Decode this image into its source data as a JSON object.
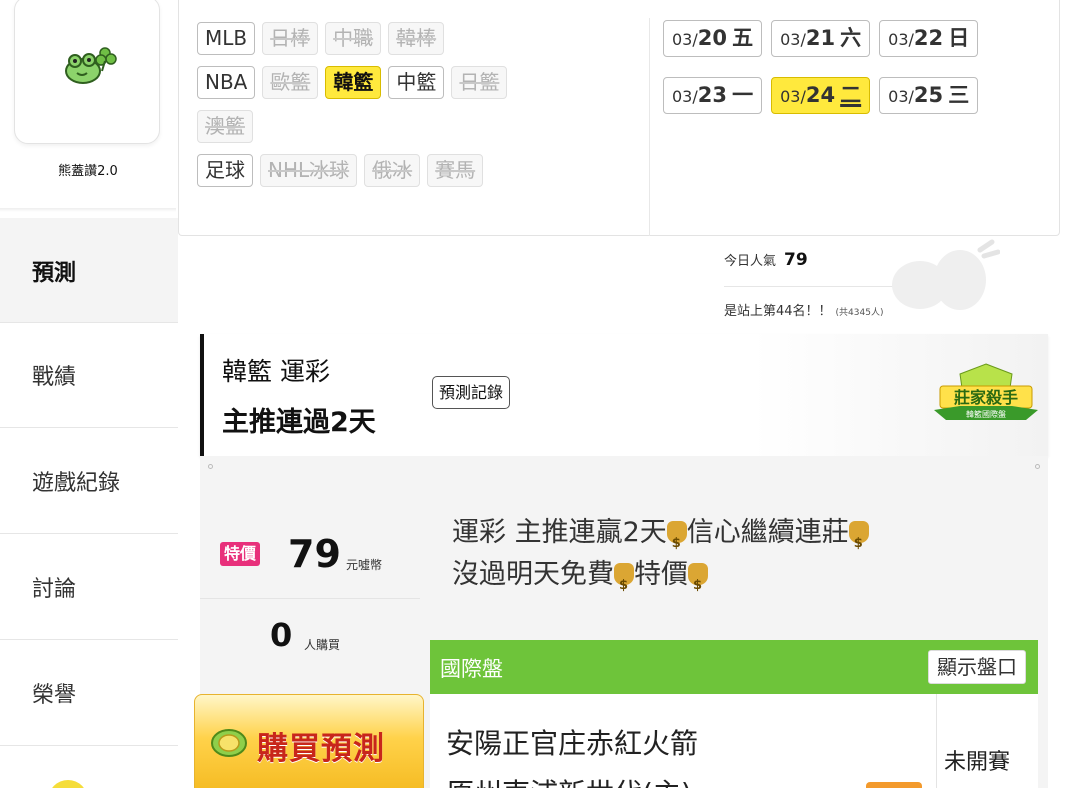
{
  "sidebar": {
    "profile_name": "熊蓋讚2.0",
    "items": [
      {
        "label": "預測",
        "active": true
      },
      {
        "label": "戰績",
        "active": false
      },
      {
        "label": "遊戲紀錄",
        "active": false
      },
      {
        "label": "討論",
        "active": false
      },
      {
        "label": "榮譽",
        "active": false
      }
    ]
  },
  "leagues": {
    "rows": [
      [
        {
          "label": "MLB",
          "state": "normal"
        },
        {
          "label": "日棒",
          "state": "off"
        },
        {
          "label": "中職",
          "state": "off"
        },
        {
          "label": "韓棒",
          "state": "off"
        }
      ],
      [
        {
          "label": "NBA",
          "state": "normal"
        },
        {
          "label": "歐籃",
          "state": "off"
        },
        {
          "label": "韓籃",
          "state": "on"
        },
        {
          "label": "中籃",
          "state": "normal"
        },
        {
          "label": "日籃",
          "state": "off"
        }
      ],
      [
        {
          "label": "澳籃",
          "state": "off"
        }
      ],
      [
        {
          "label": "足球",
          "state": "normal"
        },
        {
          "label": "NHL冰球",
          "state": "off"
        },
        {
          "label": "俄冰",
          "state": "off"
        },
        {
          "label": "賽馬",
          "state": "off"
        }
      ]
    ]
  },
  "dates": [
    [
      {
        "md": "03/",
        "d": "20",
        "w": "五",
        "state": "normal"
      },
      {
        "md": "03/",
        "d": "21",
        "w": "六",
        "state": "normal"
      },
      {
        "md": "03/",
        "d": "22",
        "w": "日",
        "state": "normal"
      }
    ],
    [
      {
        "md": "03/",
        "d": "23",
        "w": "一",
        "state": "normal"
      },
      {
        "md": "03/",
        "d": "24",
        "w": "二",
        "state": "on"
      },
      {
        "md": "03/",
        "d": "25",
        "w": "三",
        "state": "normal"
      }
    ]
  ],
  "popularity": {
    "label": "今日人氣",
    "value": "79",
    "rank_text": "是站上第44名！！",
    "rank_sub": "(共4345人)"
  },
  "banner": {
    "line1": "韓籃 運彩",
    "line2": "主推連過2天",
    "record_button": "預測記錄",
    "badge_main": "莊家殺手",
    "badge_sub": "韓籃國際盤"
  },
  "offer": {
    "special_tag": "特價",
    "price": "79",
    "price_unit": "元噓幣",
    "buyers": "0",
    "buyers_unit": "人購買",
    "buy_button": "購買預測",
    "desc_segments": [
      "運彩 主推連贏2天",
      "信心繼續連莊",
      "沒過明天免費",
      "特價"
    ]
  },
  "market": {
    "label": "國際盤",
    "show_button": "顯示盤口",
    "team1": "安陽正官庄赤紅火箭",
    "team2": "原州東浦新世代(主)",
    "status": "未開賽"
  },
  "colors": {
    "highlight": "#ffe93d",
    "special_pink": "#e8307b",
    "market_green": "#6ec43a",
    "buy_red": "#c8261b"
  }
}
